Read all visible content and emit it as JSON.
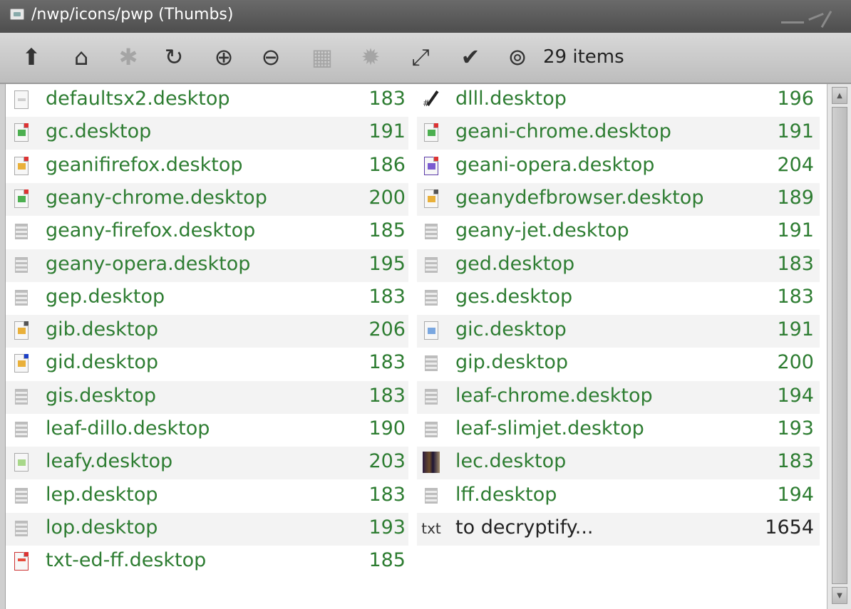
{
  "window": {
    "title": "/nwp/icons/pwp (Thumbs)"
  },
  "toolbar": {
    "items_count": "29 items",
    "buttons": [
      {
        "name": "up-arrow-icon",
        "glyph": "⬆"
      },
      {
        "name": "home-icon",
        "glyph": "⌂"
      },
      {
        "name": "pin-icon",
        "glyph": "✱"
      },
      {
        "name": "refresh-icon",
        "glyph": "↻"
      },
      {
        "name": "zoom-in-icon",
        "glyph": "⊕"
      },
      {
        "name": "zoom-out-icon",
        "glyph": "⊖"
      },
      {
        "name": "thumbnails-icon",
        "glyph": "▦"
      },
      {
        "name": "settings-icon",
        "glyph": "✹"
      },
      {
        "name": "resize-icon",
        "glyph": "⤢"
      },
      {
        "name": "checkmark-icon",
        "glyph": "✔"
      },
      {
        "name": "lifebuoy-icon",
        "glyph": "⊚"
      }
    ]
  },
  "files_left": [
    {
      "name": "defaultsx2.desktop",
      "size": "183",
      "icon": "doc-blank-icon"
    },
    {
      "name": "gc.desktop",
      "size": "191",
      "icon": "geany-chrome-icon"
    },
    {
      "name": "geanifirefox.desktop",
      "size": "186",
      "icon": "geany-firefox-icon"
    },
    {
      "name": "geany-chrome.desktop",
      "size": "200",
      "icon": "geany-chrome-icon"
    },
    {
      "name": "geany-firefox.desktop",
      "size": "185",
      "icon": "text-grid-icon"
    },
    {
      "name": "geany-opera.desktop",
      "size": "195",
      "icon": "text-grid-icon"
    },
    {
      "name": "gep.desktop",
      "size": "183",
      "icon": "text-grid-icon"
    },
    {
      "name": "gib.desktop",
      "size": "206",
      "icon": "geany-doc-icon"
    },
    {
      "name": "gid.desktop",
      "size": "183",
      "icon": "geany-doc-blue-icon"
    },
    {
      "name": "gis.desktop",
      "size": "183",
      "icon": "text-grid-icon"
    },
    {
      "name": "leaf-dillo.desktop",
      "size": "190",
      "icon": "text-grid-icon"
    },
    {
      "name": "leafy.desktop",
      "size": "203",
      "icon": "leaf-doc-icon"
    },
    {
      "name": "lep.desktop",
      "size": "183",
      "icon": "text-grid-icon"
    },
    {
      "name": "lop.desktop",
      "size": "193",
      "icon": "text-grid-icon"
    },
    {
      "name": "txt-ed-ff.desktop",
      "size": "185",
      "icon": "text-editor-icon"
    }
  ],
  "files_right": [
    {
      "name": "dlll.desktop",
      "size": "196",
      "icon": "pen-icon"
    },
    {
      "name": "geani-chrome.desktop",
      "size": "191",
      "icon": "geany-chrome-icon"
    },
    {
      "name": "geani-opera.desktop",
      "size": "204",
      "icon": "geany-opera-icon"
    },
    {
      "name": "geanydefbrowser.desktop",
      "size": "189",
      "icon": "geany-doc-icon"
    },
    {
      "name": "geany-jet.desktop",
      "size": "191",
      "icon": "text-grid-icon"
    },
    {
      "name": "ged.desktop",
      "size": "183",
      "icon": "text-grid-icon"
    },
    {
      "name": "ges.desktop",
      "size": "183",
      "icon": "text-grid-icon"
    },
    {
      "name": "gic.desktop",
      "size": "191",
      "icon": "doc-blue-icon"
    },
    {
      "name": "gip.desktop",
      "size": "200",
      "icon": "text-grid-icon"
    },
    {
      "name": "leaf-chrome.desktop",
      "size": "194",
      "icon": "text-grid-icon"
    },
    {
      "name": "leaf-slimjet.desktop",
      "size": "193",
      "icon": "text-grid-icon"
    },
    {
      "name": "lec.desktop",
      "size": "183",
      "icon": "photo-thumbnail-icon"
    },
    {
      "name": "lff.desktop",
      "size": "194",
      "icon": "text-grid-icon"
    },
    {
      "name": "to decryptify...",
      "size": "1654",
      "icon": "txt-icon",
      "icon_text": "txt"
    }
  ]
}
